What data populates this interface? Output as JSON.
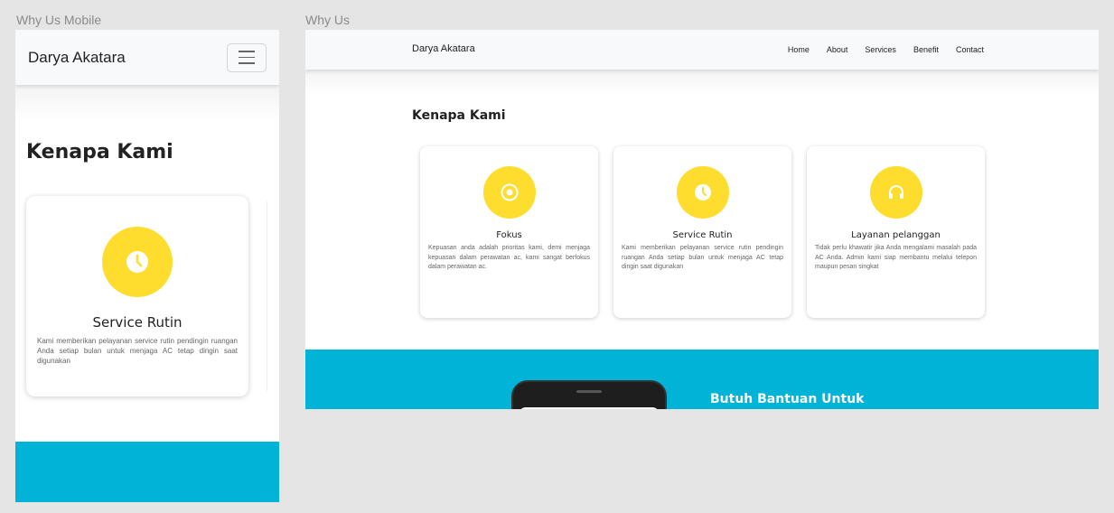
{
  "labels": {
    "mobile": "Why Us Mobile",
    "desktop": "Why Us"
  },
  "brand": "Darya Akatara",
  "nav": [
    "Home",
    "About",
    "Services",
    "Benefit",
    "Contact"
  ],
  "section_title": "Kenapa Kami",
  "cards": [
    {
      "title": "Fokus",
      "icon": "target-icon",
      "text": "Kepuasan anda adalah prioritas kami, demi menjaga kepuasan dalam perawatan ac, kami sangat berfokus dalam perawatan ac."
    },
    {
      "title": "Service Rutin",
      "icon": "clock-icon",
      "text": "Kami memberikan pelayanan service rutin pendingin ruangan Anda setiap bulan untuk menjaga AC tetap dingin saat digunakan"
    },
    {
      "title": "Layanan pelanggan",
      "icon": "headphones-icon",
      "text": "Tidak perlu khawatir jika Anda mengalami masalah pada AC Anda. Admin kami siap membantu melalui telepon maupun pesan singkat"
    }
  ],
  "cta_title": "Butuh Bantuan Untuk",
  "colors": {
    "accent": "#ffdd2e",
    "cyan": "#01b3d7",
    "navbar": "#f8f9fa"
  }
}
